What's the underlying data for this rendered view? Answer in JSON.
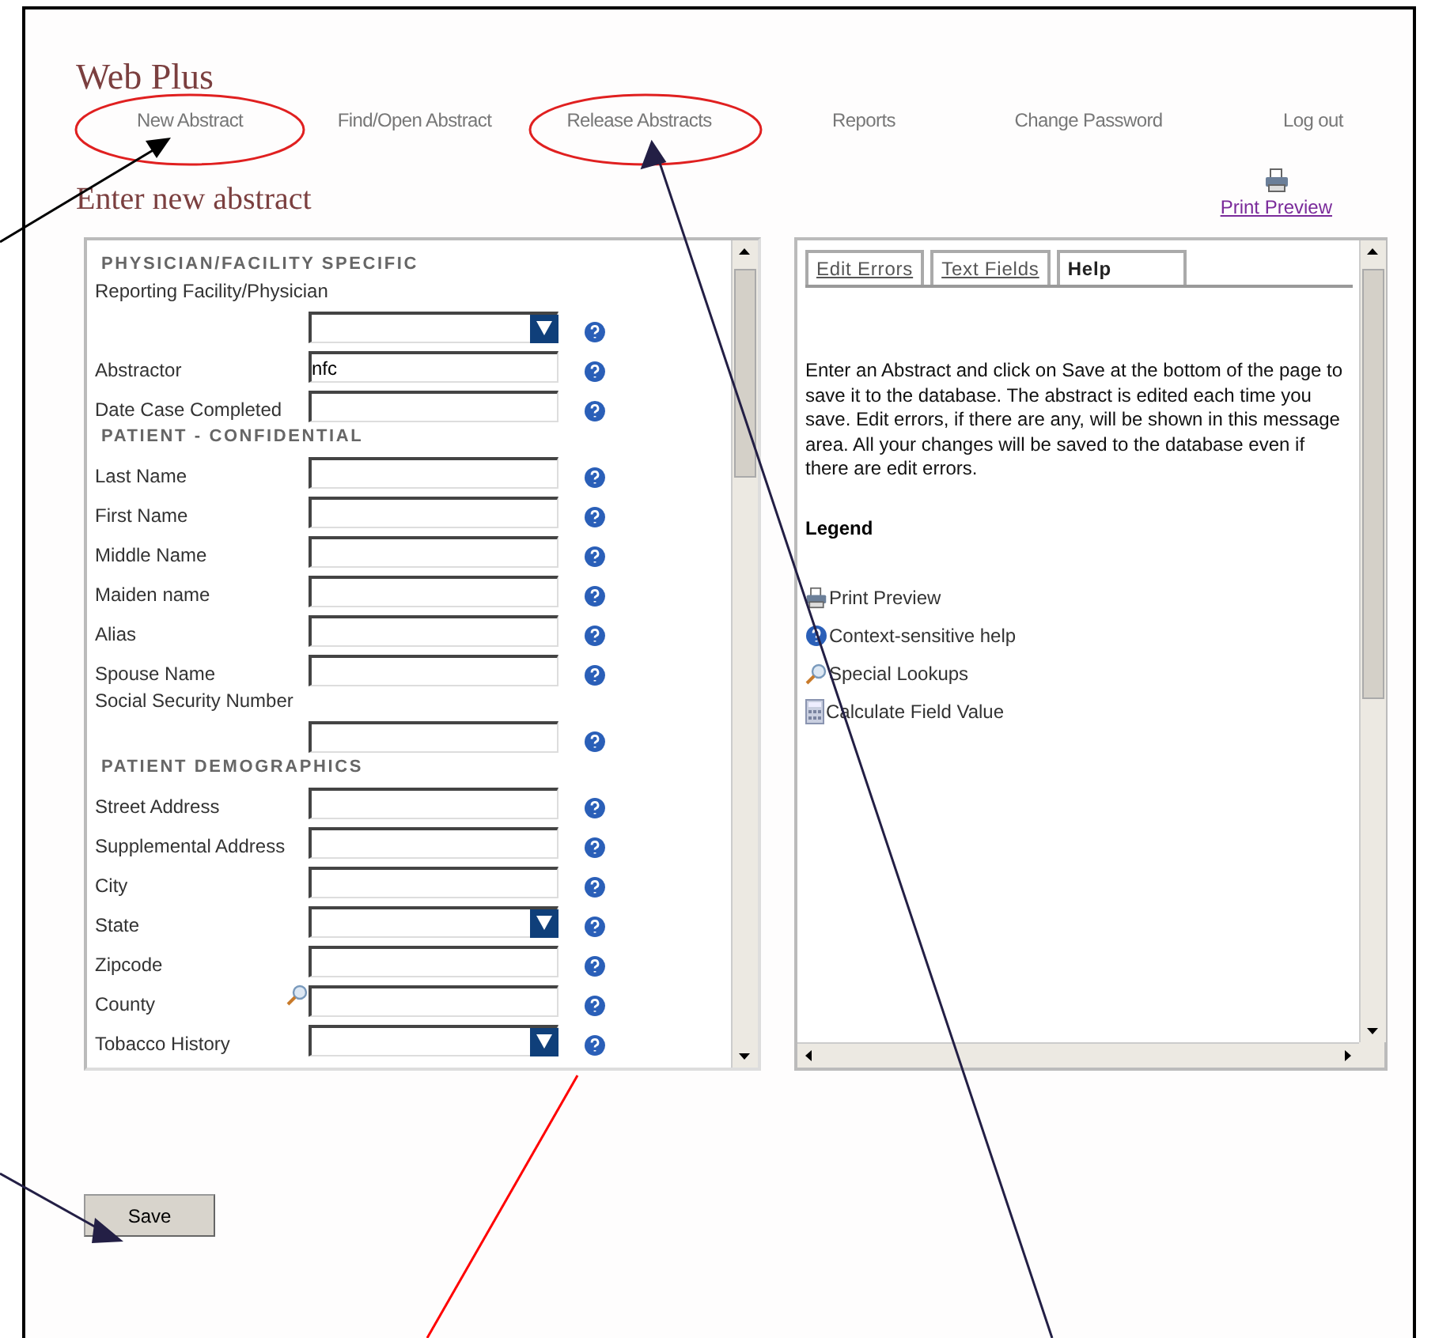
{
  "app_title": "Web Plus",
  "nav": [
    {
      "label": "New Abstract"
    },
    {
      "label": "Find/Open Abstract"
    },
    {
      "label": "Release Abstracts"
    },
    {
      "label": "Reports"
    },
    {
      "label": "Change Password"
    },
    {
      "label": "Log out"
    }
  ],
  "page_title": "Enter new abstract",
  "print_preview": "Print Preview",
  "form": {
    "sections": [
      {
        "heading": "PHYSICIAN/FACILITY SPECIFIC",
        "fields": [
          {
            "label": "Reporting Facility/Physician",
            "kind": "select",
            "label_above": true
          },
          {
            "label": "Abstractor",
            "kind": "text",
            "label_above": false,
            "value": "nfc"
          },
          {
            "label": "Date Case Completed",
            "kind": "text",
            "label_above": false
          }
        ]
      },
      {
        "heading": "PATIENT - CONFIDENTIAL",
        "fields": [
          {
            "label": "Last Name",
            "kind": "text",
            "label_above": false
          },
          {
            "label": "First Name",
            "kind": "text",
            "label_above": false
          },
          {
            "label": "Middle Name",
            "kind": "text",
            "label_above": false
          },
          {
            "label": "Maiden name",
            "kind": "text",
            "label_above": false
          },
          {
            "label": "Alias",
            "kind": "text",
            "label_above": false
          },
          {
            "label": "Spouse Name",
            "kind": "text",
            "label_above": false
          },
          {
            "label": "Social Security Number",
            "kind": "text",
            "label_above": true
          }
        ]
      },
      {
        "heading": "PATIENT DEMOGRAPHICS",
        "fields": [
          {
            "label": "Street Address",
            "kind": "text",
            "label_above": false
          },
          {
            "label": "Supplemental Address",
            "kind": "text",
            "label_above": false
          },
          {
            "label": "City",
            "kind": "text",
            "label_above": false
          },
          {
            "label": "State",
            "kind": "select",
            "label_above": false
          },
          {
            "label": "Zipcode",
            "kind": "text",
            "label_above": false
          },
          {
            "label": "County",
            "kind": "lookup",
            "label_above": false
          },
          {
            "label": "Tobacco History",
            "kind": "select",
            "label_above": false
          }
        ]
      }
    ]
  },
  "help_panel": {
    "tabs": [
      {
        "label": "Edit Errors",
        "selected": false
      },
      {
        "label": "Text Fields",
        "selected": false
      },
      {
        "label": "Help",
        "selected": true
      }
    ],
    "text": "Enter an Abstract and click on Save at the bottom of the page to save it to the database. The abstract is edited each time you save. Edit errors, if there are any, will be shown in this message area. All your changes will be saved to the database even if there are edit errors.",
    "legend_title": "Legend",
    "legend": [
      {
        "kind": "print",
        "label": "Print Preview"
      },
      {
        "kind": "help",
        "label": "Context-sensitive help"
      },
      {
        "kind": "lookup",
        "label": "Special Lookups"
      },
      {
        "kind": "calculate",
        "label": "Calculate Field Value"
      }
    ]
  },
  "save_button": "Save"
}
